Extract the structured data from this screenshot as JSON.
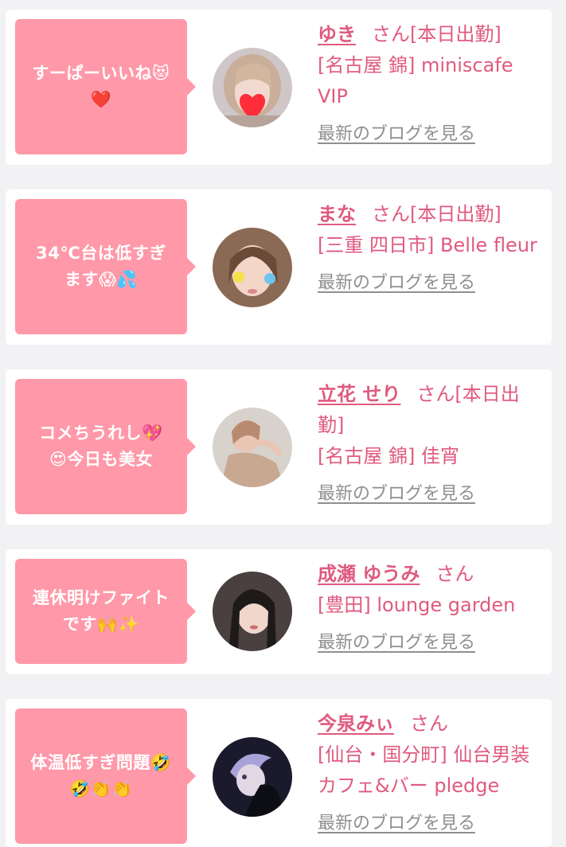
{
  "items": [
    {
      "comment": "すーぱーいいね😻\n❤️",
      "name": "ゆき",
      "suffix": "さん[本日出勤]",
      "shop": "[名古屋 錦] miniscafe VIP",
      "blog_link": "最新のブログを見る"
    },
    {
      "comment": "34℃台は低すぎ\nます😱💦",
      "name": "まな",
      "suffix": "さん[本日出勤]",
      "shop": "[三重 四日市] Belle fleur",
      "blog_link": "最新のブログを見る"
    },
    {
      "comment": "コメちうれし💖\n😍今日も美女",
      "name": "立花 せり",
      "suffix": "さん[本日出勤]",
      "shop": "[名古屋 錦] 佳宵",
      "blog_link": "最新のブログを見る"
    },
    {
      "comment": "連休明けファイト\nです🙌✨",
      "name": "成瀬 ゆうみ",
      "suffix": "さん",
      "shop": "[豊田] lounge garden",
      "blog_link": "最新のブログを見る"
    },
    {
      "comment": "体温低すぎ問題🤣\n🤣👏👏",
      "name": "今泉みぃ",
      "suffix": "さん",
      "shop": "[仙台・国分町] 仙台男装カフェ&バー pledge",
      "blog_link": "最新のブログを見る"
    }
  ],
  "colors": {
    "accent": "#e05a80",
    "bubble": "#ff98a8",
    "link_gray": "#8f8f8f",
    "background": "#f2f2f4"
  }
}
